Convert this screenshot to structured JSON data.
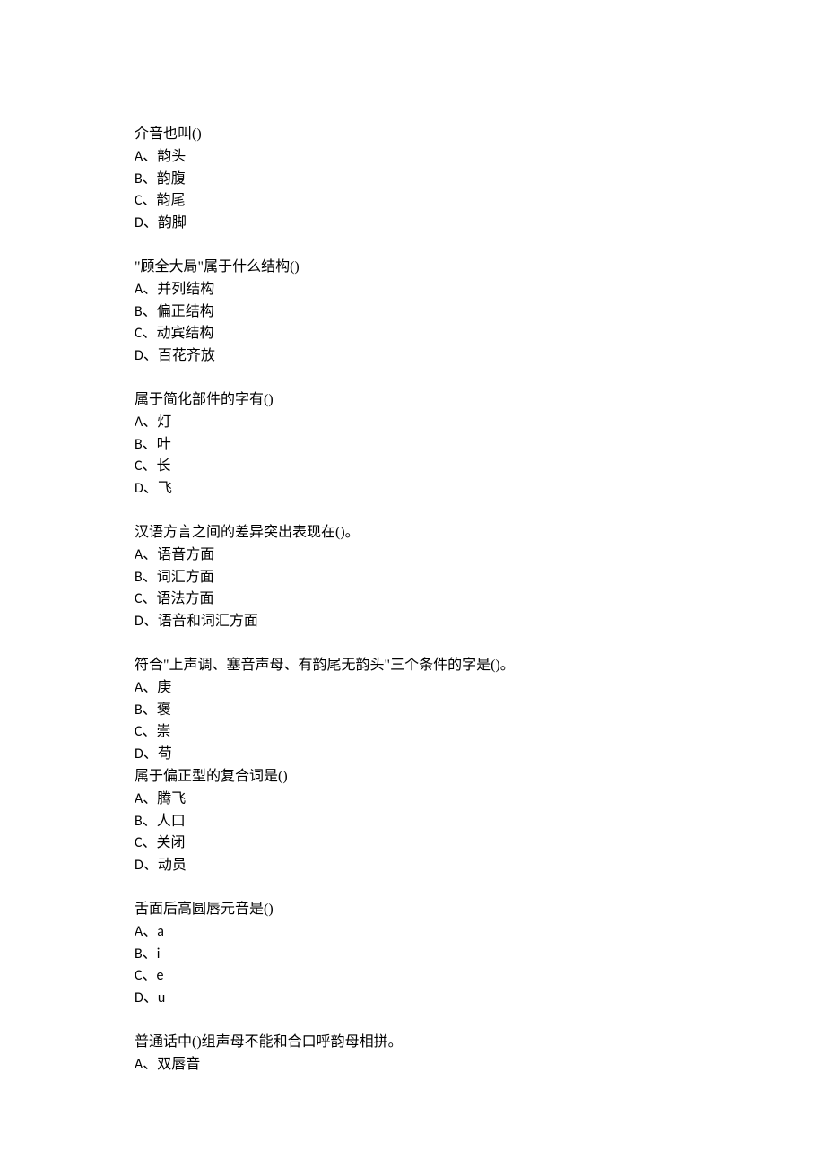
{
  "questions": [
    {
      "text": "介音也叫()",
      "options": [
        "A、韵头",
        "B、韵腹",
        "C、韵尾",
        "D、韵脚"
      ]
    },
    {
      "text": "\"顾全大局\"属于什么结构()",
      "options": [
        "A、并列结构",
        "B、偏正结构",
        "C、动宾结构",
        "D、百花齐放"
      ]
    },
    {
      "text": "属于简化部件的字有()",
      "options": [
        "A、灯",
        "B、叶",
        "C、长",
        "D、飞"
      ]
    },
    {
      "text": "汉语方言之间的差异突出表现在()。",
      "options": [
        "A、语音方面",
        "B、词汇方面",
        "C、语法方面",
        "D、语音和词汇方面"
      ]
    },
    {
      "text": "符合\"上声调、塞音声母、有韵尾无韵头\"三个条件的字是()。",
      "options": [
        "A、庚",
        "B、褒",
        "C、崇",
        "D、苟"
      ]
    },
    {
      "text": "属于偏正型的复合词是()",
      "options": [
        "A、腾飞",
        "B、人口",
        "C、关闭",
        "D、动员"
      ]
    },
    {
      "text": "舌面后高圆唇元音是()",
      "options": [
        "A、a",
        "B、i",
        "C、e",
        "D、u"
      ]
    },
    {
      "text": "普通话中()组声母不能和合口呼韵母相拼。",
      "options": [
        "A、双唇音"
      ]
    }
  ]
}
